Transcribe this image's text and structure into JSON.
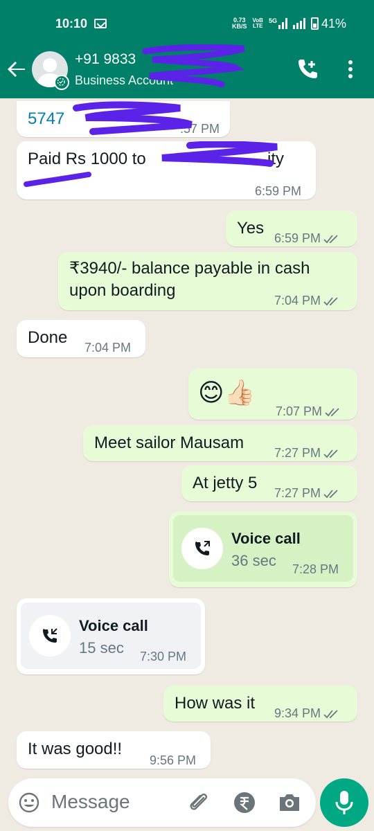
{
  "status_bar": {
    "time": "10:10",
    "net_speed_top": "0.73",
    "net_speed_bottom": "KB/S",
    "volte_top": "VoB",
    "volte_bottom": "LTE",
    "net_5g": "5G",
    "battery": "41%"
  },
  "header": {
    "contact_name": "+91 9833",
    "subtitle": "Business Account",
    "icons": [
      "back-arrow-icon",
      "avatar",
      "business-badge-icon",
      "add-call-icon",
      "more-options-icon"
    ]
  },
  "messages": [
    {
      "dir": "in",
      "text": "5747",
      "time": ":57 PM"
    },
    {
      "dir": "in",
      "text": "Paid Rs 1000 to",
      "text_tail": "ity",
      "time": "6:59 PM"
    },
    {
      "dir": "out",
      "text": "Yes",
      "time": "6:59 PM"
    },
    {
      "dir": "out",
      "line1": "₹3940/- balance payable in cash",
      "line2": "upon boarding",
      "time": "7:04 PM"
    },
    {
      "dir": "in",
      "text": "Done",
      "time": "7:04 PM"
    },
    {
      "dir": "out",
      "text": "😊👍🏻",
      "time": "7:07 PM"
    },
    {
      "dir": "out",
      "text": "Meet sailor Mausam",
      "time": "7:27 PM"
    },
    {
      "dir": "out",
      "text": "At jetty 5",
      "time": "7:27 PM"
    },
    {
      "dir": "out",
      "type": "call",
      "title": "Voice call",
      "duration": "36 sec",
      "time": "7:28 PM"
    },
    {
      "dir": "in",
      "type": "call",
      "title": "Voice call",
      "duration": "15 sec",
      "time": "7:30 PM"
    },
    {
      "dir": "out",
      "text": "How was it",
      "time": "9:34 PM"
    },
    {
      "dir": "in",
      "text": "It was good!!",
      "time": "9:56 PM"
    }
  ],
  "composer": {
    "placeholder": "Message",
    "icons": [
      "emoji-icon",
      "attach-icon",
      "rupee-icon",
      "camera-icon",
      "mic-icon"
    ]
  },
  "colors": {
    "header": "#008069",
    "chat_bg": "#efeae2",
    "outgoing": "#e7fcd6",
    "incoming": "#ffffff",
    "read_ticks": "#667781",
    "accent": "#00a884",
    "redaction": "#5b22e8"
  }
}
